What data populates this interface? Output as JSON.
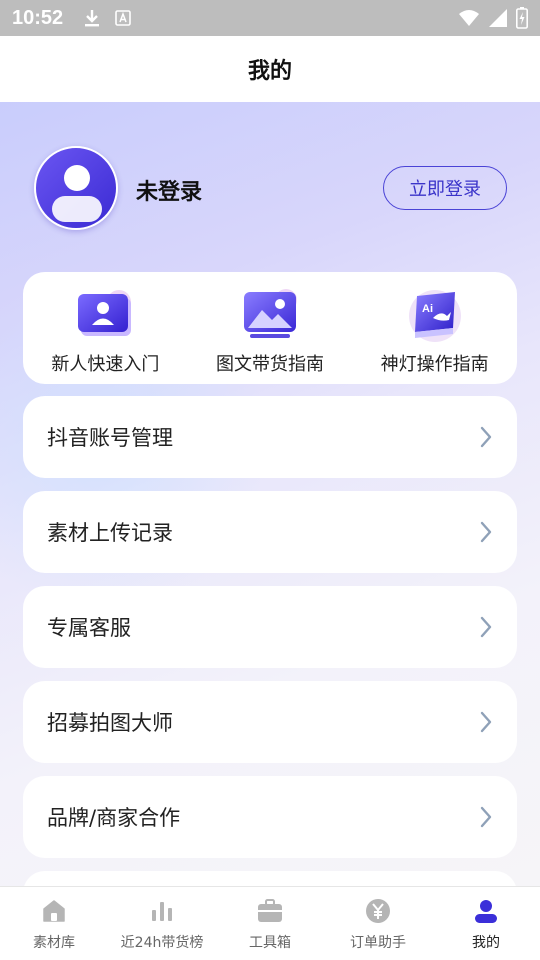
{
  "status_bar": {
    "time": "10:52",
    "icons": [
      "download-icon",
      "a-icon",
      "wifi-icon",
      "signal-icon",
      "battery-icon"
    ]
  },
  "header": {
    "title": "我的"
  },
  "profile": {
    "username": "未登录",
    "login_button": "立即登录",
    "avatar_icon": "user-icon"
  },
  "guides": [
    {
      "label": "新人快速入门",
      "icon": "user-card-icon"
    },
    {
      "label": "图文带货指南",
      "icon": "image-gallery-icon"
    },
    {
      "label": "神灯操作指南",
      "icon": "ai-book-icon"
    }
  ],
  "menu": [
    {
      "label": "抖音账号管理"
    },
    {
      "label": "素材上传记录"
    },
    {
      "label": "专属客服"
    },
    {
      "label": "招募拍图大师"
    },
    {
      "label": "品牌/商家合作"
    }
  ],
  "tabbar": [
    {
      "label": "素材库",
      "icon": "home-icon",
      "active": false
    },
    {
      "label": "近24h带货榜",
      "icon": "bar-chart-icon",
      "active": false
    },
    {
      "label": "工具箱",
      "icon": "toolbox-icon",
      "active": false
    },
    {
      "label": "订单助手",
      "icon": "yen-icon",
      "active": false
    },
    {
      "label": "我的",
      "icon": "user-icon",
      "active": true
    }
  ],
  "colors": {
    "accent": "#3a33c9",
    "active_tab": "#3b2fd9",
    "inactive_tab": "#b5b5b5",
    "chevron": "#8fa1b8"
  }
}
